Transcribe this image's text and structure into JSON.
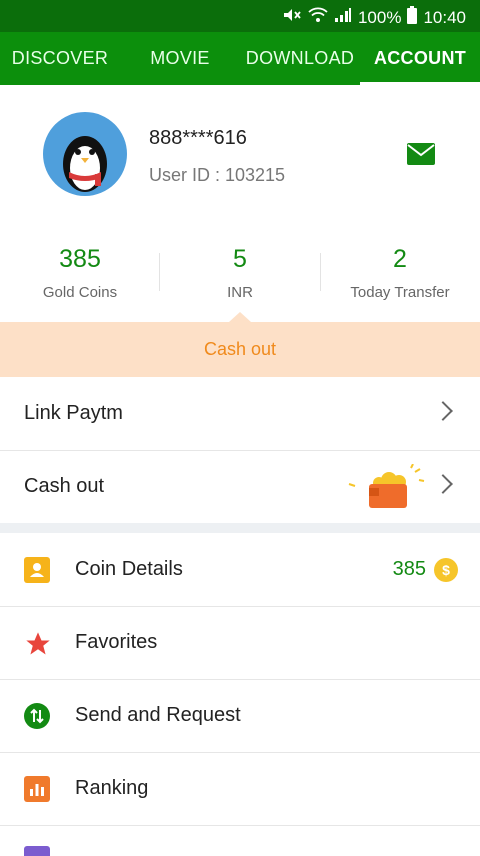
{
  "status_bar": {
    "battery": "100%",
    "time": "10:40"
  },
  "tabs": [
    {
      "label": "DISCOVER"
    },
    {
      "label": "MOVIE"
    },
    {
      "label": "DOWNLOAD"
    },
    {
      "label": "ACCOUNT"
    }
  ],
  "profile": {
    "username": "888****616",
    "user_id": "User ID : 103215"
  },
  "stats": [
    {
      "value": "385",
      "label": "Gold Coins"
    },
    {
      "value": "5",
      "label": "INR"
    },
    {
      "value": "2",
      "label": "Today Transfer"
    }
  ],
  "cash_banner": {
    "label": "Cash out"
  },
  "rows": [
    {
      "label": "Link Paytm"
    },
    {
      "label": "Cash out"
    }
  ],
  "menu": [
    {
      "label": "Coin Details",
      "value": "385",
      "icon": "coin-details-icon"
    },
    {
      "label": "Favorites",
      "icon": "star-icon"
    },
    {
      "label": "Send and Request",
      "icon": "transfer-icon"
    },
    {
      "label": "Ranking",
      "icon": "ranking-icon"
    }
  ],
  "colors": {
    "tab_bar": "#0c8f0c",
    "status_bar": "#0b6e0b",
    "accent_green": "#138a13",
    "banner": "#fde0c7",
    "banner_text": "#f08a1c"
  }
}
